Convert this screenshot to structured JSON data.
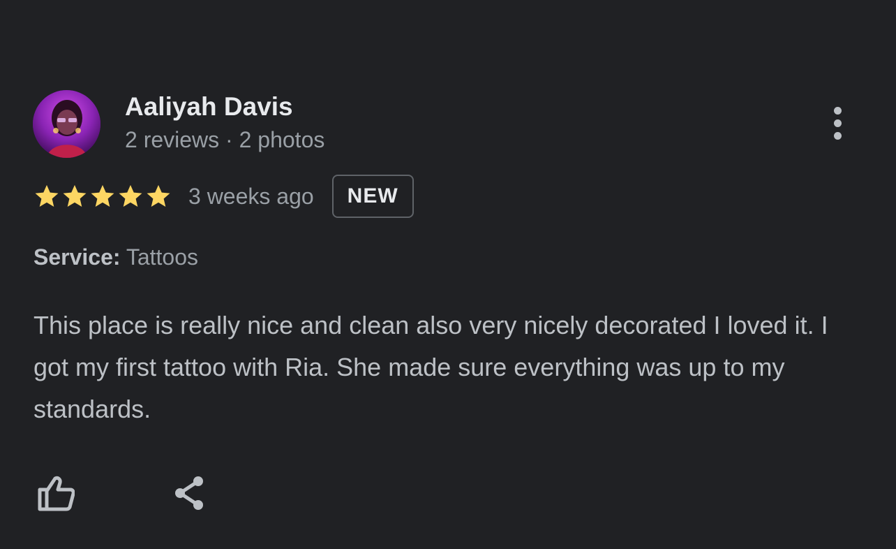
{
  "review": {
    "author_name": "Aaliyah Davis",
    "author_meta": "2 reviews · 2 photos",
    "rating": 5,
    "rating_max": 5,
    "time_ago": "3 weeks ago",
    "badge": "NEW",
    "service_label": "Service:",
    "service_value": "Tattoos",
    "text": "This place is really nice and clean also very nicely decorated I loved it. I got my first tattoo with Ria. She made sure everything was up to my standards."
  },
  "icons": {
    "more": "more-vert-icon",
    "star": "star-icon",
    "like": "thumb-up-icon",
    "share": "share-icon"
  },
  "colors": {
    "background": "#202124",
    "star": "#fdd663",
    "primary_text": "#e8eaed",
    "secondary_text": "#9aa0a6",
    "body_text": "#bdc1c6",
    "badge_border": "#5f6368"
  }
}
